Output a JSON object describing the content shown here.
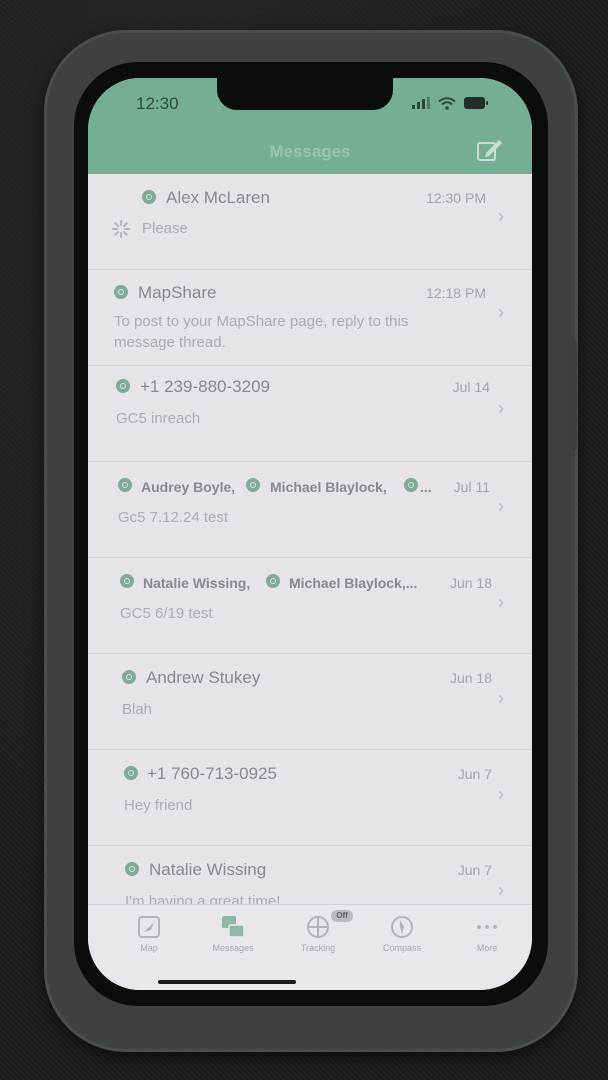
{
  "status_bar": {
    "time": "12:30"
  },
  "nav": {
    "title": "Messages",
    "compose_icon": "compose-icon"
  },
  "threads": [
    {
      "name": "Alex McLaren",
      "time": "12:30 PM",
      "preview": "Please",
      "sending": true
    },
    {
      "name": "MapShare",
      "time": "12:18 PM",
      "preview": "To post to your MapShare page, reply to this message thread."
    },
    {
      "name": "+1 239-880-3209",
      "time": "Jul 14",
      "preview": "GC5 inreach"
    },
    {
      "names": [
        "Audrey Boyle,",
        "Michael Blaylock,"
      ],
      "name_overflow": "...",
      "time": "Jul 11",
      "preview": "Gc5 7.12.24 test"
    },
    {
      "names": [
        "Natalie Wissing,",
        "Michael Blaylock,..."
      ],
      "time": "Jun 18",
      "preview": "GC5 6/19 test"
    },
    {
      "name": "Andrew Stukey",
      "time": "Jun 18",
      "preview": "Blah"
    },
    {
      "name": "+1 760-713-0925",
      "time": "Jun 7",
      "preview": "Hey friend"
    },
    {
      "name": "Natalie Wissing",
      "time": "Jun 7",
      "preview": "I'm having a great time!"
    }
  ],
  "tabs": [
    {
      "label": "Map",
      "icon": "map-icon"
    },
    {
      "label": "Messages",
      "icon": "messages-icon"
    },
    {
      "label": "Tracking",
      "icon": "tracking-icon",
      "badge": "Off"
    },
    {
      "label": "Compass",
      "icon": "compass-icon"
    },
    {
      "label": "More",
      "icon": "more-icon"
    }
  ],
  "colors": {
    "accent": "#73ae95",
    "screen_bg": "#e6e3e9",
    "case": "#3d413f"
  }
}
